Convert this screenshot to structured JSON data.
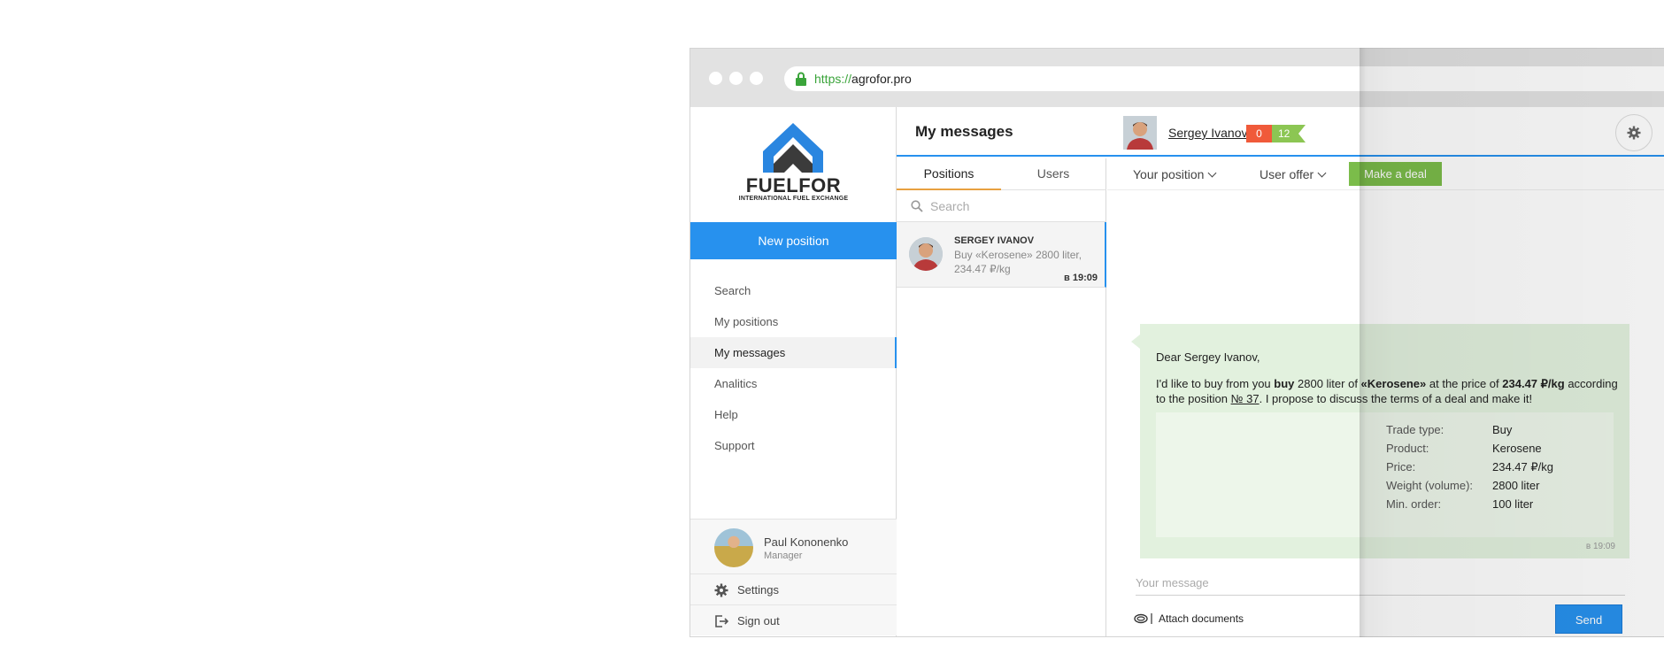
{
  "browser": {
    "url_scheme": "https://",
    "url_host": "agrofor.pro"
  },
  "logo": {
    "brand": "FUELFOR",
    "tagline": "INTERNATIONAL FUEL EXCHANGE",
    "colors": {
      "blue": "#2a86e0",
      "dark": "#333333"
    }
  },
  "sidebar": {
    "new_position_label": "New position",
    "items": [
      {
        "label": "Search",
        "active": false
      },
      {
        "label": "My positions",
        "active": false
      },
      {
        "label": "My messages",
        "active": true
      },
      {
        "label": "Analitics",
        "active": false
      },
      {
        "label": "Help",
        "active": false
      },
      {
        "label": "Support",
        "active": false
      }
    ],
    "user": {
      "name": "Paul Kononenko",
      "role": "Manager"
    },
    "settings_label": "Settings",
    "signout_label": "Sign out"
  },
  "header": {
    "title": "My messages",
    "contact_name": "Sergey Ivanov",
    "negative_count": "0",
    "positive_count": "12"
  },
  "positions": {
    "tabs": [
      {
        "label": "Positions",
        "active": true
      },
      {
        "label": "Users",
        "active": false
      }
    ],
    "search_placeholder": "Search",
    "conversations": [
      {
        "name": "SERGEY IVANOV",
        "preview": "Buy «Kerosene» 2800 liter, 234.47 ₽/kg",
        "time": "в 19:09"
      }
    ]
  },
  "chat": {
    "your_position_label": "Your position",
    "user_offer_label": "User offer",
    "make_deal_label": "Make a deal",
    "message": {
      "greeting": "Dear Sergey Ivanov,",
      "text_1": "I'd like to buy from you ",
      "text_buy": "buy",
      "text_2": " 2800 liter of ",
      "text_product": "«Kerosene»",
      "text_3": " at the price of ",
      "text_price": "234.47 ₽/kg",
      "text_4": " according to the position ",
      "text_position": "№ 37",
      "text_5": ". I propose to discuss the terms of a deal and make it!",
      "details": [
        {
          "key": "Trade type:",
          "value": "Buy"
        },
        {
          "key": "Product:",
          "value": "Kerosene"
        },
        {
          "key": "Price:",
          "value": "234.47 ₽/kg"
        },
        {
          "key": "Weight (volume):",
          "value": "2800 liter"
        },
        {
          "key": "Min. order:",
          "value": "100 liter"
        }
      ],
      "time": "в 19:09"
    },
    "input_placeholder": "Your message",
    "attach_label": "Attach documents",
    "send_label": "Send"
  },
  "colors": {
    "accent": "#2791ee",
    "deal_green": "#7bbc4a",
    "bubble": "#e2f1de",
    "badge_red": "#f05a3a",
    "badge_green": "#8cc653",
    "tab_underline": "#e8a040"
  }
}
